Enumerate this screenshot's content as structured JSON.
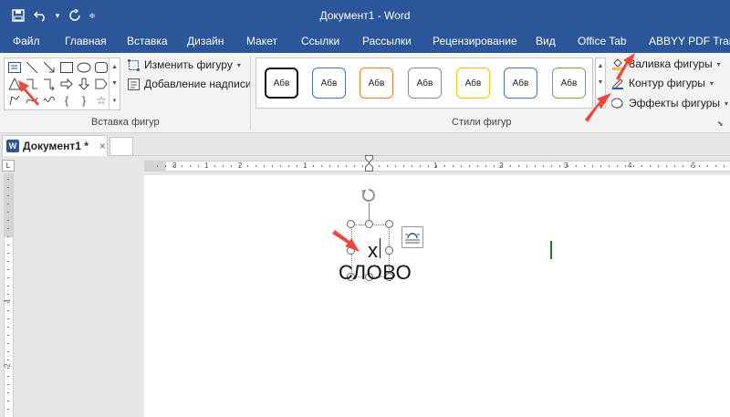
{
  "window": {
    "title": "Документ1 - Word",
    "qat": {
      "save_icon": "save-icon",
      "undo_icon": "undo-icon",
      "redo_icon": "redo-icon"
    }
  },
  "ribbon_tabs": [
    "Файл",
    "Главная",
    "Вставка",
    "Дизайн",
    "Макет",
    "Ссылки",
    "Рассылки",
    "Рецензирование",
    "Вид",
    "Office Tab",
    "ABBYY PDF Transf"
  ],
  "insert_shapes": {
    "group_label": "Вставка фигур",
    "edit_shape": "Изменить фигуру",
    "add_text": "Добавление надписи"
  },
  "shape_styles": {
    "group_label": "Стили фигур",
    "items": [
      {
        "label": "Абв",
        "border": "#111111",
        "width": 2
      },
      {
        "label": "Абв",
        "border": "#4472c4",
        "width": 1
      },
      {
        "label": "Абв",
        "border": "#ed7d31",
        "width": 1
      },
      {
        "label": "Абв",
        "border": "#8c8c8c",
        "width": 1
      },
      {
        "label": "Абв",
        "border": "#ffc000",
        "width": 1
      },
      {
        "label": "Абв",
        "border": "#4472c4",
        "width": 1
      },
      {
        "label": "Абв",
        "border": "#70ad47",
        "width": 1
      }
    ],
    "fill": "Заливка фигуры",
    "outline": "Контур фигуры",
    "effects": "Эффекты фигуры"
  },
  "document_tab": {
    "label": "Документ1 *",
    "close": "×"
  },
  "ruler": {
    "corner": "L",
    "h_labels": [
      "3",
      "1",
      "2",
      "1",
      "1",
      "2",
      "3",
      "4",
      "5"
    ],
    "v_labels": [
      "1",
      "2"
    ]
  },
  "document": {
    "char": "х",
    "word": "СЛОВО"
  },
  "colors": {
    "accent": "#2b579a",
    "arrow": "#f0473a",
    "cursor": "#2c7a2c"
  }
}
